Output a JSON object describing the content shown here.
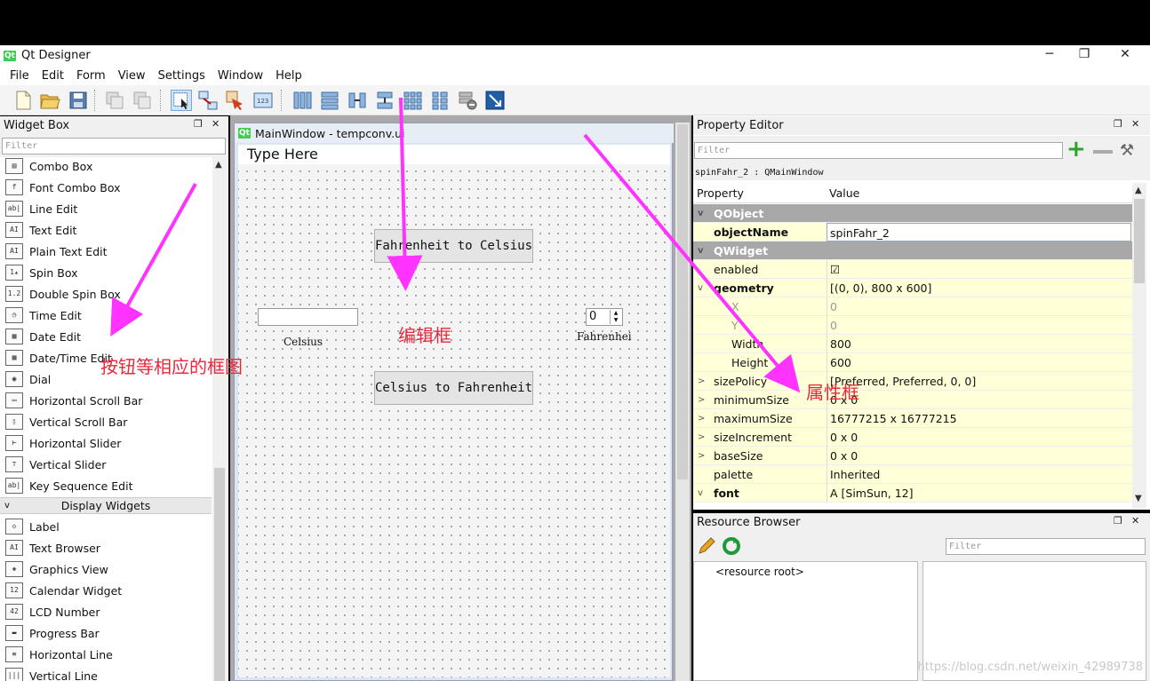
{
  "window": {
    "app_icon": "qt-logo-icon",
    "title": "Qt Designer",
    "controls": [
      "─",
      "❐",
      "✕"
    ]
  },
  "menu": [
    "File",
    "Edit",
    "Form",
    "View",
    "Settings",
    "Window",
    "Help"
  ],
  "toolbar": {
    "icons": [
      "new-file-icon",
      "open-folder-icon",
      "save-icon",
      "cut-icon",
      "copy-icon",
      "edit-widgets-icon",
      "edit-signals-slots-icon",
      "edit-buddies-icon",
      "edit-tab-order-icon",
      "layout-horizontal-icon",
      "layout-vertical-icon",
      "layout-horizontal-splitter-icon",
      "layout-vertical-splitter-icon",
      "layout-grid-icon",
      "layout-form-icon",
      "break-layout-icon",
      "adjust-size-icon"
    ]
  },
  "widget_box": {
    "title": "Widget Box",
    "filter_placeholder": "Filter",
    "items": [
      {
        "label": "Combo Box",
        "glyph": "▤"
      },
      {
        "label": "Font Combo Box",
        "glyph": "f"
      },
      {
        "label": "Line Edit",
        "glyph": "ab|"
      },
      {
        "label": "Text Edit",
        "glyph": "AI"
      },
      {
        "label": "Plain Text Edit",
        "glyph": "AI"
      },
      {
        "label": "Spin Box",
        "glyph": "1▴"
      },
      {
        "label": "Double Spin Box",
        "glyph": "1.2"
      },
      {
        "label": "Time Edit",
        "glyph": "◷"
      },
      {
        "label": "Date Edit",
        "glyph": "▦"
      },
      {
        "label": "Date/Time Edit",
        "glyph": "▦"
      },
      {
        "label": "Dial",
        "glyph": "◉"
      },
      {
        "label": "Horizontal Scroll Bar",
        "glyph": "▭"
      },
      {
        "label": "Vertical Scroll Bar",
        "glyph": "▯"
      },
      {
        "label": "Horizontal Slider",
        "glyph": "⊢"
      },
      {
        "label": "Vertical Slider",
        "glyph": "⊤"
      },
      {
        "label": "Key Sequence Edit",
        "glyph": "ab|"
      }
    ],
    "category": "Display Widgets",
    "display_items": [
      {
        "label": "Label",
        "glyph": "◇"
      },
      {
        "label": "Text Browser",
        "glyph": "AI"
      },
      {
        "label": "Graphics View",
        "glyph": "◈"
      },
      {
        "label": "Calendar Widget",
        "glyph": "12"
      },
      {
        "label": "LCD Number",
        "glyph": "42"
      },
      {
        "label": "Progress Bar",
        "glyph": "▬"
      },
      {
        "label": "Horizontal Line",
        "glyph": "≡"
      },
      {
        "label": "Vertical Line",
        "glyph": "|||"
      }
    ]
  },
  "form": {
    "title": "MainWindow - tempconv.ui",
    "menu_placeholder": "Type Here",
    "button_f2c": "Fahrenheit to Celsius",
    "button_c2f": "Celsius to Fahrenheit",
    "celsius_label": "Celsius",
    "fahrenheit_label": "Fahrenhei",
    "spin_value": "0"
  },
  "property_editor": {
    "title": "Property Editor",
    "filter_placeholder": "Filter",
    "object_info": "spinFahr_2 : QMainWindow",
    "col_property": "Property",
    "col_value": "Value",
    "rows": [
      {
        "name": "QObject",
        "value": "",
        "kind": "cat"
      },
      {
        "name": "objectName",
        "value": "spinFahr_2",
        "kind": "bold"
      },
      {
        "name": "QWidget",
        "value": "",
        "kind": "cat"
      },
      {
        "name": "enabled",
        "value": "☑",
        "kind": "plain"
      },
      {
        "name": "geometry",
        "value": "[(0, 0), 800 x 600]",
        "kind": "bold-expanded"
      },
      {
        "name": "X",
        "value": "0",
        "kind": "sub-gray"
      },
      {
        "name": "Y",
        "value": "0",
        "kind": "sub-gray"
      },
      {
        "name": "Width",
        "value": "800",
        "kind": "sub"
      },
      {
        "name": "Height",
        "value": "600",
        "kind": "sub"
      },
      {
        "name": "sizePolicy",
        "value": "[Preferred, Preferred, 0, 0]",
        "kind": "collapsed"
      },
      {
        "name": "minimumSize",
        "value": "0 x 0",
        "kind": "collapsed"
      },
      {
        "name": "maximumSize",
        "value": "16777215 x 16777215",
        "kind": "collapsed"
      },
      {
        "name": "sizeIncrement",
        "value": "0 x 0",
        "kind": "collapsed"
      },
      {
        "name": "baseSize",
        "value": "0 x 0",
        "kind": "collapsed"
      },
      {
        "name": "palette",
        "value": "Inherited",
        "kind": "plain"
      },
      {
        "name": "font",
        "value": "A  [SimSun, 12]",
        "kind": "bold-expanded"
      }
    ]
  },
  "resource_browser": {
    "title": "Resource Browser",
    "filter_placeholder": "Filter",
    "root_item": "<resource root>"
  },
  "annotations": {
    "widgets_note": "按钮等相应的框图",
    "edit_note": "编辑框",
    "property_note": "属性框",
    "color": "#e8283c",
    "arrow_color": "#ff33ff"
  },
  "watermark": "https://blog.csdn.net/weixin_42989738"
}
